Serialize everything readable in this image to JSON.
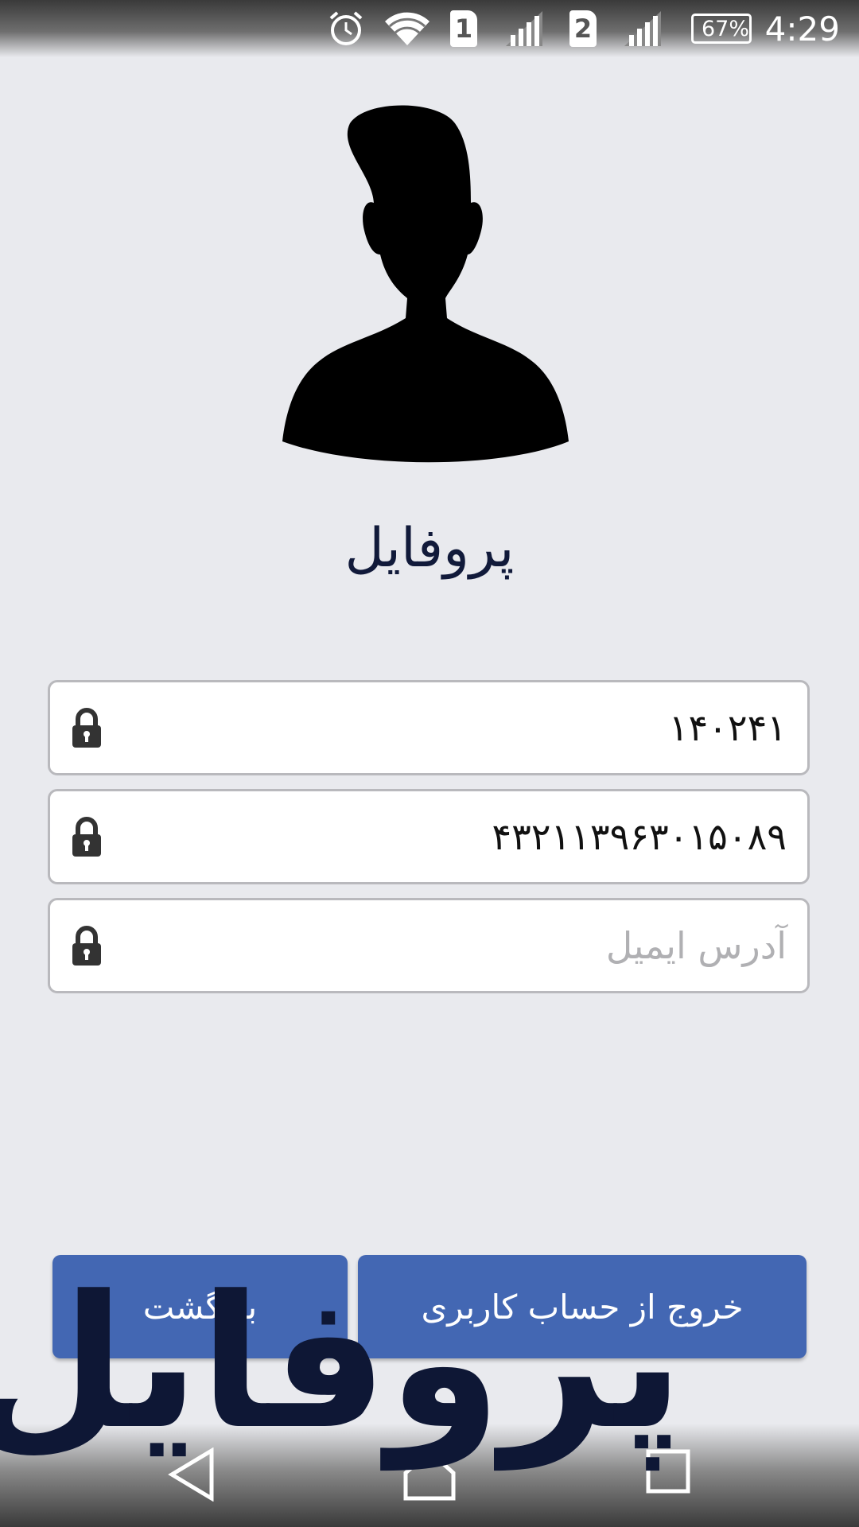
{
  "status_bar": {
    "time": "4:29",
    "battery": "67%",
    "sim1": "1",
    "sim2": "2",
    "icons": [
      "alarm-icon",
      "wifi-icon",
      "sim1-icon",
      "signal-icon",
      "sim2-icon",
      "signal-icon",
      "battery-icon"
    ]
  },
  "profile": {
    "title": "پروفایل",
    "fields": [
      {
        "value": "۱۴۰۲۴۱",
        "icon": "lock-icon"
      },
      {
        "value": "۴۳۲۱۱۳۹۶۳۰۱۵۰۸۹",
        "icon": "lock-icon"
      },
      {
        "placeholder": "آدرس ایمیل",
        "icon": "lock-icon"
      }
    ]
  },
  "buttons": {
    "logout": "خروج از حساب کاربری",
    "back": "بازگشت"
  },
  "overlay": {
    "big_title": "پروفایل"
  },
  "colors": {
    "background": "#e9eaee",
    "button": "#4367b3",
    "title": "#111a3a"
  }
}
